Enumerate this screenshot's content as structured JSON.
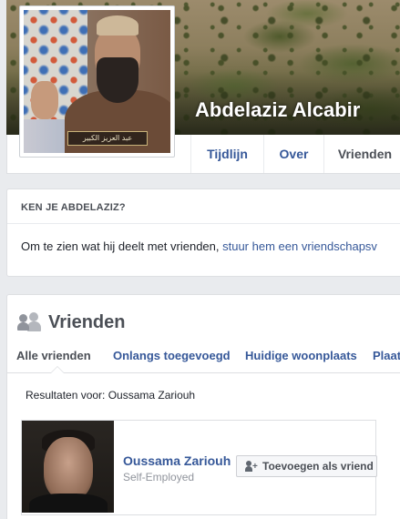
{
  "profile": {
    "name": "Abdelaziz Alcabir",
    "photo_caption": "عبد العزيز الكبير"
  },
  "nav": {
    "tabs": [
      {
        "label": "Tijdlijn"
      },
      {
        "label": "Over"
      },
      {
        "label": "Vrienden",
        "active": true
      }
    ]
  },
  "know_card": {
    "title": "KEN JE ABDELAZIZ?",
    "text": "Om te zien wat hij deelt met vrienden, ",
    "link": "stuur hem een vriendschapsv"
  },
  "friends": {
    "title": "Vrienden",
    "tabs": [
      {
        "label": "Alle vrienden",
        "active": true
      },
      {
        "label": "Onlangs toegevoegd"
      },
      {
        "label": "Huidige woonplaats"
      },
      {
        "label": "Plaat"
      }
    ],
    "results_label": "Resultaten voor: Oussama Zariouh",
    "items": [
      {
        "name": "Oussama Zariouh",
        "subtitle": "Self-Employed",
        "button_label": "Toevoegen als vriend"
      }
    ]
  },
  "colors": {
    "link": "#365899",
    "background": "#e9ebee",
    "secondary_text": "#90949c"
  }
}
